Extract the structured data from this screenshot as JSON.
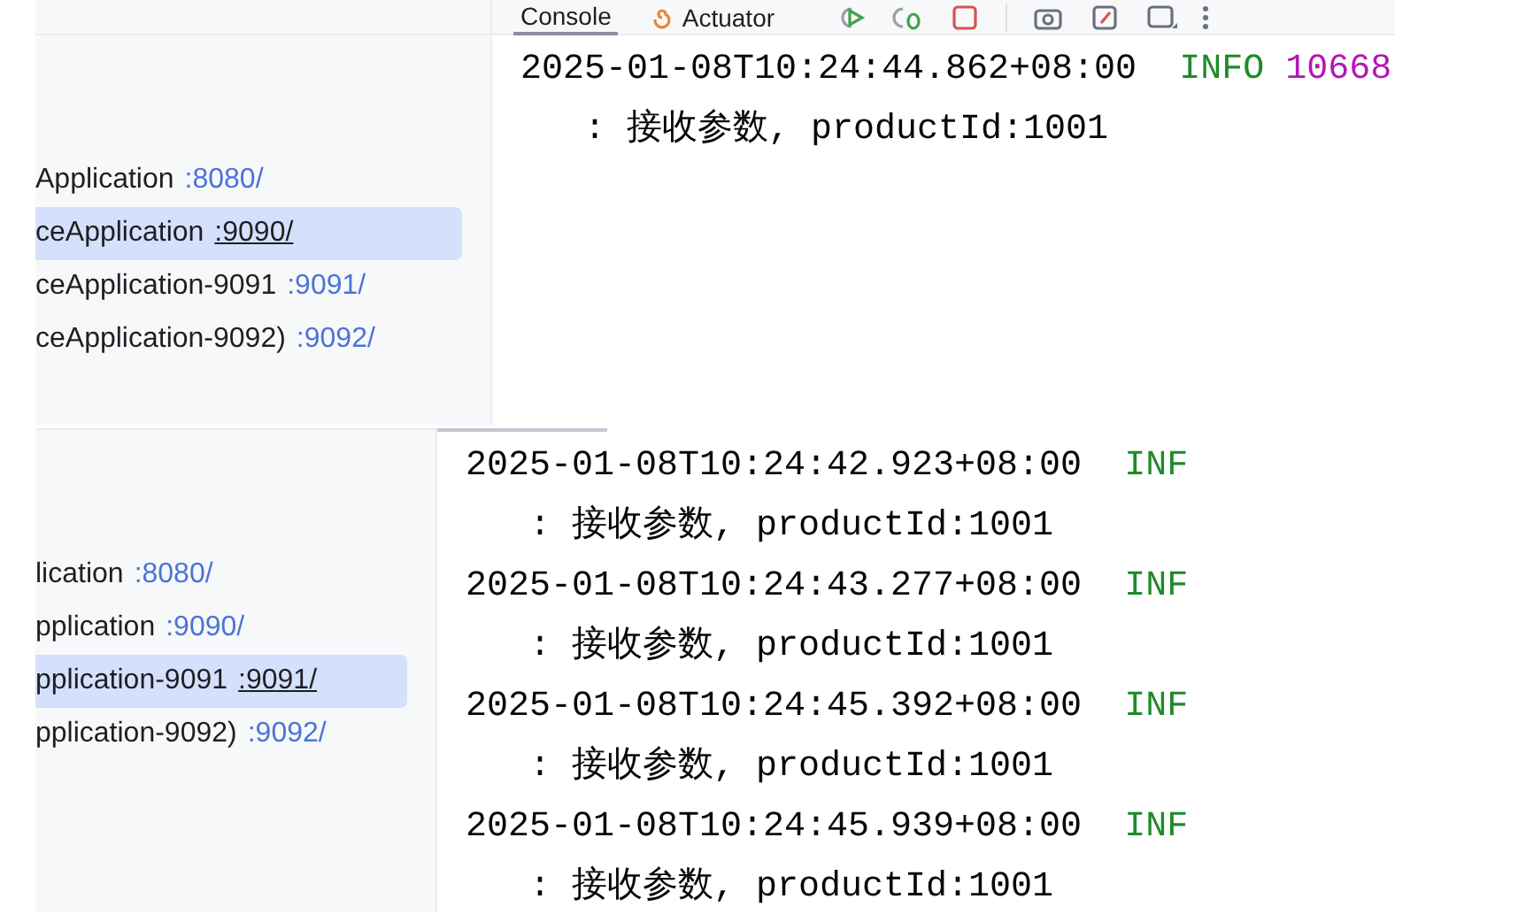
{
  "panels": [
    {
      "tabs": [
        {
          "label": "Console",
          "selected": true,
          "icon": false
        },
        {
          "label": "Actuator",
          "selected": false,
          "icon": true
        }
      ],
      "services": [
        {
          "name": "Application",
          "port": ":8080/",
          "selected": false
        },
        {
          "name": "ceApplication",
          "port": ":9090/",
          "selected": true
        },
        {
          "name": "ceApplication-9091",
          "port": ":9091/",
          "selected": false
        },
        {
          "name": "ceApplication-9092)",
          "port": ":9092/",
          "selected": false
        }
      ],
      "log": [
        {
          "timestamp": "2025-01-08T10:24:44.862+08:00",
          "level": "INFO",
          "pid": "10668",
          "message": ": 接收参数, productId:1001"
        }
      ]
    },
    {
      "services": [
        {
          "name": "lication",
          "port": ":8080/",
          "selected": false
        },
        {
          "name": "pplication",
          "port": ":9090/",
          "selected": false
        },
        {
          "name": "pplication-9091",
          "port": ":9091/",
          "selected": true
        },
        {
          "name": "pplication-9092)",
          "port": ":9092/",
          "selected": false
        }
      ],
      "log": [
        {
          "timestamp": "2025-01-08T10:24:42.923+08:00",
          "level": "INF",
          "message": ": 接收参数, productId:1001"
        },
        {
          "timestamp": "2025-01-08T10:24:43.277+08:00",
          "level": "INF",
          "message": ": 接收参数, productId:1001"
        },
        {
          "timestamp": "2025-01-08T10:24:45.392+08:00",
          "level": "INF",
          "message": ": 接收参数, productId:1001"
        },
        {
          "timestamp": "2025-01-08T10:24:45.939+08:00",
          "level": "INF",
          "message": ": 接收参数, productId:1001"
        }
      ]
    }
  ]
}
